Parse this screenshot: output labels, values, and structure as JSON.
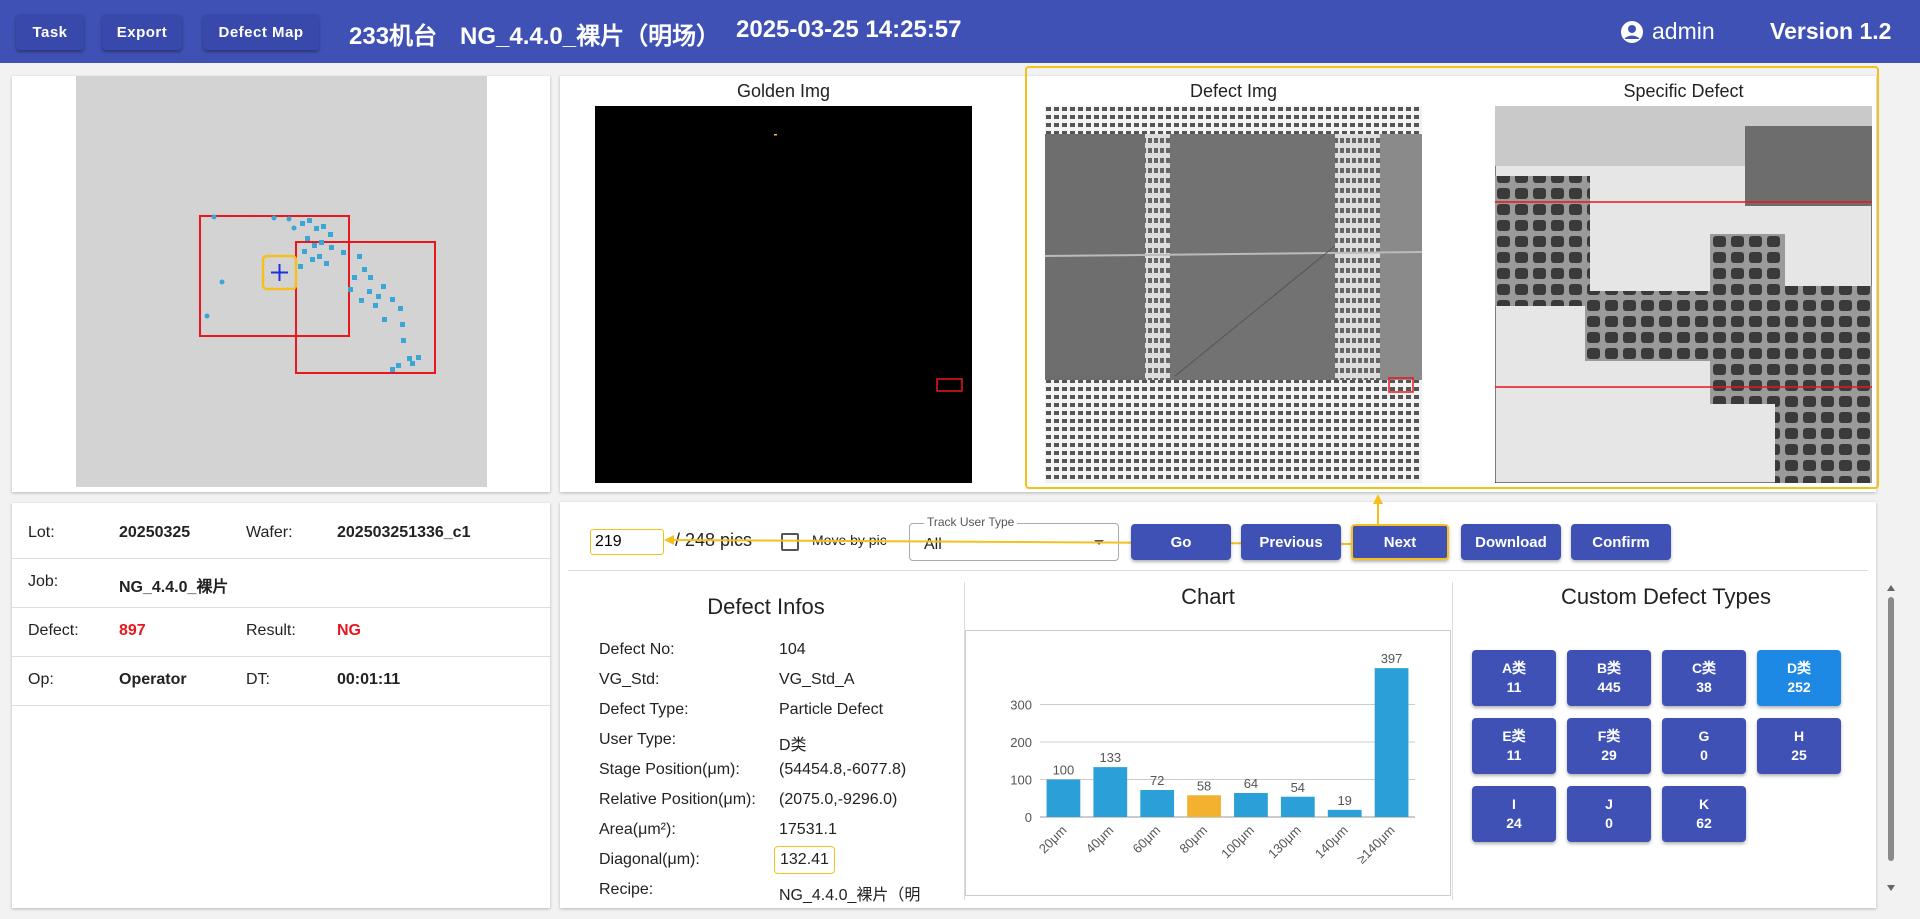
{
  "topbar": {
    "task": "Task",
    "export": "Export",
    "defect_map": "Defect Map",
    "machine": "233机台",
    "recipe": "NG_4.4.0_裸片（明场）",
    "datetime": "2025-03-25 14:25:57",
    "user": "admin",
    "version": "Version 1.2"
  },
  "images": {
    "golden": "Golden Img",
    "defect": "Defect Img",
    "specific": "Specific Defect"
  },
  "navigation": {
    "current_pic": "219",
    "total": "/ 248 pics",
    "move_by_pic": "Move by pic",
    "track_label": "Track User Type",
    "track_value": "All",
    "go": "Go",
    "previous": "Previous",
    "next": "Next",
    "download": "Download",
    "confirm": "Confirm"
  },
  "lot_info": {
    "lot_label": "Lot:",
    "lot": "20250325",
    "wafer_label": "Wafer:",
    "wafer": "202503251336_c1",
    "job_label": "Job:",
    "job": "NG_4.4.0_裸片",
    "defect_label": "Defect:",
    "defect": "897",
    "result_label": "Result:",
    "result": "NG",
    "op_label": "Op:",
    "op": "Operator",
    "dt_label": "DT:",
    "dt": "00:01:11"
  },
  "defect_infos": {
    "title": "Defect Infos",
    "rows": [
      {
        "label": "Defect No:",
        "value": "104"
      },
      {
        "label": "VG_Std:",
        "value": "VG_Std_A"
      },
      {
        "label": "Defect Type:",
        "value": "Particle Defect"
      },
      {
        "label": "User Type:",
        "value": "D类"
      },
      {
        "label": "Stage Position(μm):",
        "value": "(54454.8,-6077.8)"
      },
      {
        "label": "Relative Position(μm):",
        "value": "(2075.0,-9296.0)"
      },
      {
        "label": "Area(μm²):",
        "value": "17531.1"
      },
      {
        "label": "Diagonal(μm):",
        "value": "132.41"
      },
      {
        "label": "Recipe:",
        "value": "NG_4.4.0_裸片（明"
      }
    ]
  },
  "chart_title": "Chart",
  "chart_data": {
    "type": "bar",
    "categories": [
      "20μm",
      "40μm",
      "60μm",
      "80μm",
      "100μm",
      "130μm",
      "140μm",
      "≥140μm"
    ],
    "values": [
      100,
      133,
      72,
      58,
      64,
      54,
      19,
      397
    ],
    "highlight_index": 3,
    "y_ticks": [
      0,
      100,
      200,
      300
    ],
    "ylim": [
      0,
      400
    ],
    "bar_color": "#2a9fd8",
    "highlight_color": "#f2b12e"
  },
  "custom_types": {
    "title": "Custom Defect Types",
    "items": [
      {
        "name": "A类",
        "count": "11"
      },
      {
        "name": "B类",
        "count": "445"
      },
      {
        "name": "C类",
        "count": "38"
      },
      {
        "name": "D类",
        "count": "252",
        "active": true
      },
      {
        "name": "E类",
        "count": "11"
      },
      {
        "name": "F类",
        "count": "29"
      },
      {
        "name": "G",
        "count": "0"
      },
      {
        "name": "H",
        "count": "25"
      },
      {
        "name": "I",
        "count": "24"
      },
      {
        "name": "J",
        "count": "0"
      },
      {
        "name": "K",
        "count": "62"
      }
    ]
  },
  "colors": {
    "primary": "#3f51b5",
    "accent_highlight": "#f5c01d",
    "error_red": "#e8171e",
    "active_type": "#1e88e5",
    "map_dot": "#3aa6d6"
  }
}
